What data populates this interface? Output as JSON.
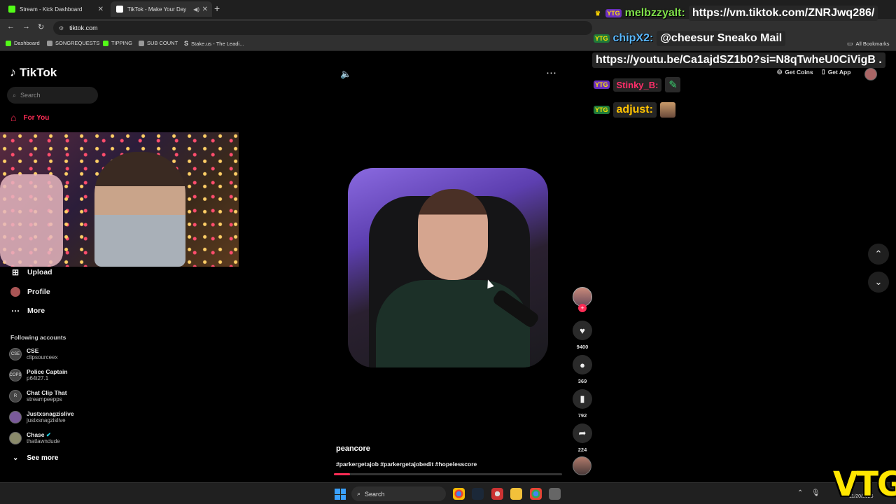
{
  "browser": {
    "tabs": [
      {
        "title": "Stream - Kick Dashboard",
        "favicon_color": "#53fc18",
        "active": false
      },
      {
        "title": "TikTok - Make Your Day",
        "favicon_color": "#ffffff",
        "active": true
      }
    ],
    "url": "tiktok.com",
    "bookmarks": [
      {
        "label": "Dashboard",
        "color": "#53fc18"
      },
      {
        "label": "SONGREQUESTS",
        "color": "#999999"
      },
      {
        "label": "TIPPING",
        "color": "#53fc18"
      },
      {
        "label": "SUB COUNT",
        "color": "#999999"
      },
      {
        "label": "Stake.us - The Leadi...",
        "color": "#cccccc"
      }
    ],
    "all_bookmarks": "All Bookmarks"
  },
  "tiktok": {
    "brand": "TikTok",
    "search_placeholder": "Search",
    "nav": {
      "for_you": "For You",
      "upload": "Upload",
      "profile": "Profile",
      "more": "More"
    },
    "following_header": "Following accounts",
    "following": [
      {
        "name": "CSE",
        "handle": "clipsourceex",
        "avatar": "CSE"
      },
      {
        "name": "Police Captain",
        "handle": "p64t27.1",
        "avatar": "COPS"
      },
      {
        "name": "Chat Clip That",
        "handle": "streampeepps",
        "avatar": "R"
      },
      {
        "name": "Justxsnagzislive",
        "handle": "justxsnagzislive",
        "avatar": ""
      },
      {
        "name": "Chase",
        "handle": "thatlawndude",
        "avatar": "",
        "verified": true
      }
    ],
    "see_more": "See more",
    "get_coins": "Get Coins",
    "get_app": "Get App",
    "video": {
      "username": "peancore",
      "hashtags": "#parkergetajob #parkergetajobedit #hopelesscore",
      "likes": "9400",
      "comments": "369",
      "saves": "792",
      "shares": "224",
      "progress": 0.07
    }
  },
  "chat": [
    {
      "badges": [
        "crown",
        "ytg"
      ],
      "user": "melbzzyalt:",
      "user_color": "#7fe04a",
      "message": "https://vm.tiktok.com/ZNRJwq286/"
    },
    {
      "badges": [
        "ytg"
      ],
      "user": "chipX2:",
      "user_color": "#5ab8ff",
      "message": "@cheesur Sneako Mail"
    },
    {
      "badges": [],
      "user": "",
      "user_color": "#ffffff",
      "message": "https://youtu.be/Ca1ajdSZ1b0?si=N8qTwheU0CiVigB ."
    },
    {
      "badges": [
        "ytg"
      ],
      "user": "Stinky_B:",
      "user_color": "#ff2e6a",
      "message": ""
    },
    {
      "badges": [
        "ytg"
      ],
      "user": "adjust:",
      "user_color": "#ffc300",
      "message": ""
    }
  ],
  "taskbar": {
    "search": "Search",
    "date": "11/20/2025"
  },
  "watermark": "VTG"
}
